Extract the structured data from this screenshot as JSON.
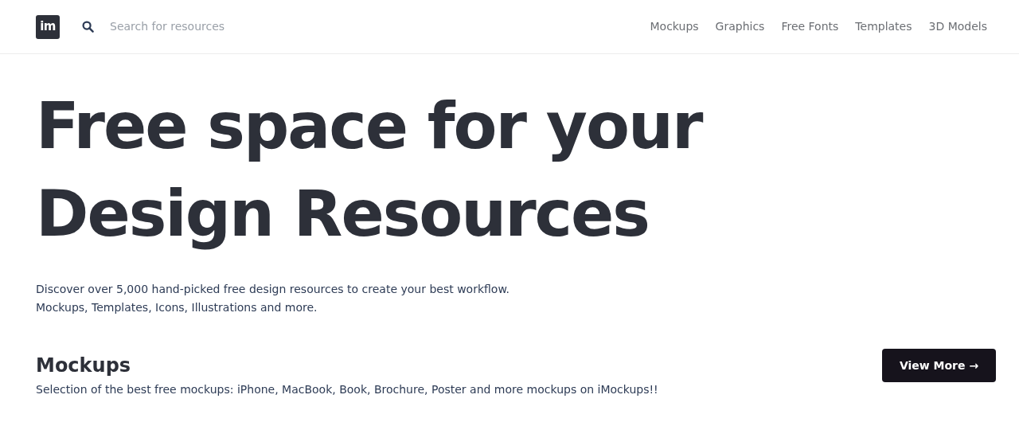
{
  "header": {
    "logo": "im",
    "search": {
      "placeholder": "Search for resources"
    },
    "nav": [
      "Mockups",
      "Graphics",
      "Free Fonts",
      "Templates",
      "3D Models"
    ]
  },
  "hero": {
    "title_lines": [
      "Free space for your",
      "Design Resources"
    ],
    "description_lines": [
      "Discover over 5,000 hand-picked free design resources to create your best workflow.",
      "Mockups, Templates, Icons, Illustrations and more."
    ]
  },
  "section": {
    "title": "Mockups",
    "button": "View More →",
    "description": "Selection of the best free mockups: iPhone, MacBook, Book, Brochure, Poster and more mockups on iMockups!!"
  }
}
